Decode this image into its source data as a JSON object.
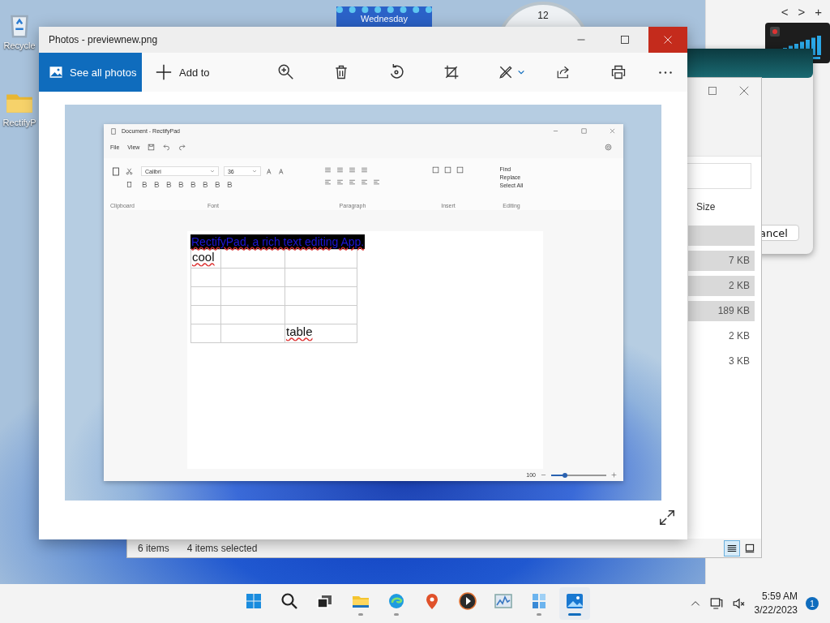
{
  "desktop": {
    "icons": [
      {
        "kind": "recycle-bin",
        "label": "Recycle"
      },
      {
        "kind": "folder",
        "label": "RectifyP"
      }
    ]
  },
  "calendar_widget": {
    "day": "Wednesday"
  },
  "clock_widget": {
    "hour": "12"
  },
  "browser_window": {
    "nav": [
      "<",
      ">",
      "+"
    ]
  },
  "dialog": {
    "button": "ancel"
  },
  "explorer_window": {
    "column": "Size",
    "rows": [
      {
        "selected": true
      },
      {
        "size": "7 KB",
        "selected": true
      },
      {
        "size": "2 KB",
        "selected": true
      },
      {
        "size": "189 KB",
        "selected": true
      },
      {
        "size": "2 KB",
        "selected": false
      },
      {
        "size": "3 KB",
        "selected": false
      }
    ],
    "status": {
      "count": "6 items",
      "selection": "4 items selected"
    },
    "views": [
      {
        "kind": "details",
        "selected": true
      },
      {
        "kind": "tiles",
        "selected": false
      }
    ]
  },
  "photos_window": {
    "title": "Photos - previewnew.png",
    "see_all": "See all photos",
    "add_to": "Add to",
    "image": {
      "title": "Document - RectifyPad",
      "menu": [
        "File",
        "View"
      ],
      "font": "Calibri",
      "size": "36",
      "editing": [
        "Find",
        "Replace",
        "Select All"
      ],
      "groups": [
        "Clipboard",
        "Font",
        "Paragraph",
        "Insert",
        "Editing"
      ],
      "heading": "RectifyPad, a rich text editing App.",
      "table": [
        [
          {
            "kind": "text",
            "text": "cool"
          },
          {
            "kind": "empty"
          },
          {
            "kind": "empty"
          }
        ],
        [
          {
            "kind": "empty"
          },
          {
            "kind": "empty"
          },
          {
            "kind": "empty"
          }
        ],
        [
          {
            "kind": "empty"
          },
          {
            "kind": "empty"
          },
          {
            "kind": "empty"
          }
        ],
        [
          {
            "kind": "empty"
          },
          {
            "kind": "empty"
          },
          {
            "kind": "empty"
          }
        ],
        [
          {
            "kind": "empty"
          },
          {
            "kind": "empty"
          },
          {
            "kind": "text",
            "text": "table"
          }
        ]
      ],
      "zoom": "100",
      "level": 0.25
    }
  },
  "taskbar": {
    "apps": [
      {
        "kind": "start",
        "running": false,
        "active": false
      },
      {
        "kind": "search",
        "running": false,
        "active": false
      },
      {
        "kind": "task-view",
        "running": false,
        "active": false
      },
      {
        "kind": "folder",
        "running": true,
        "active": false
      },
      {
        "kind": "browser",
        "running": true,
        "active": false
      },
      {
        "kind": "pin",
        "running": false,
        "active": false
      },
      {
        "kind": "play",
        "running": false,
        "active": false
      },
      {
        "kind": "chart",
        "running": false,
        "active": false
      },
      {
        "kind": "tiles",
        "running": true,
        "active": false
      },
      {
        "kind": "photo",
        "running": true,
        "active": true
      }
    ],
    "time": "5:59 AM",
    "date": "3/22/2023",
    "badge": "1"
  }
}
